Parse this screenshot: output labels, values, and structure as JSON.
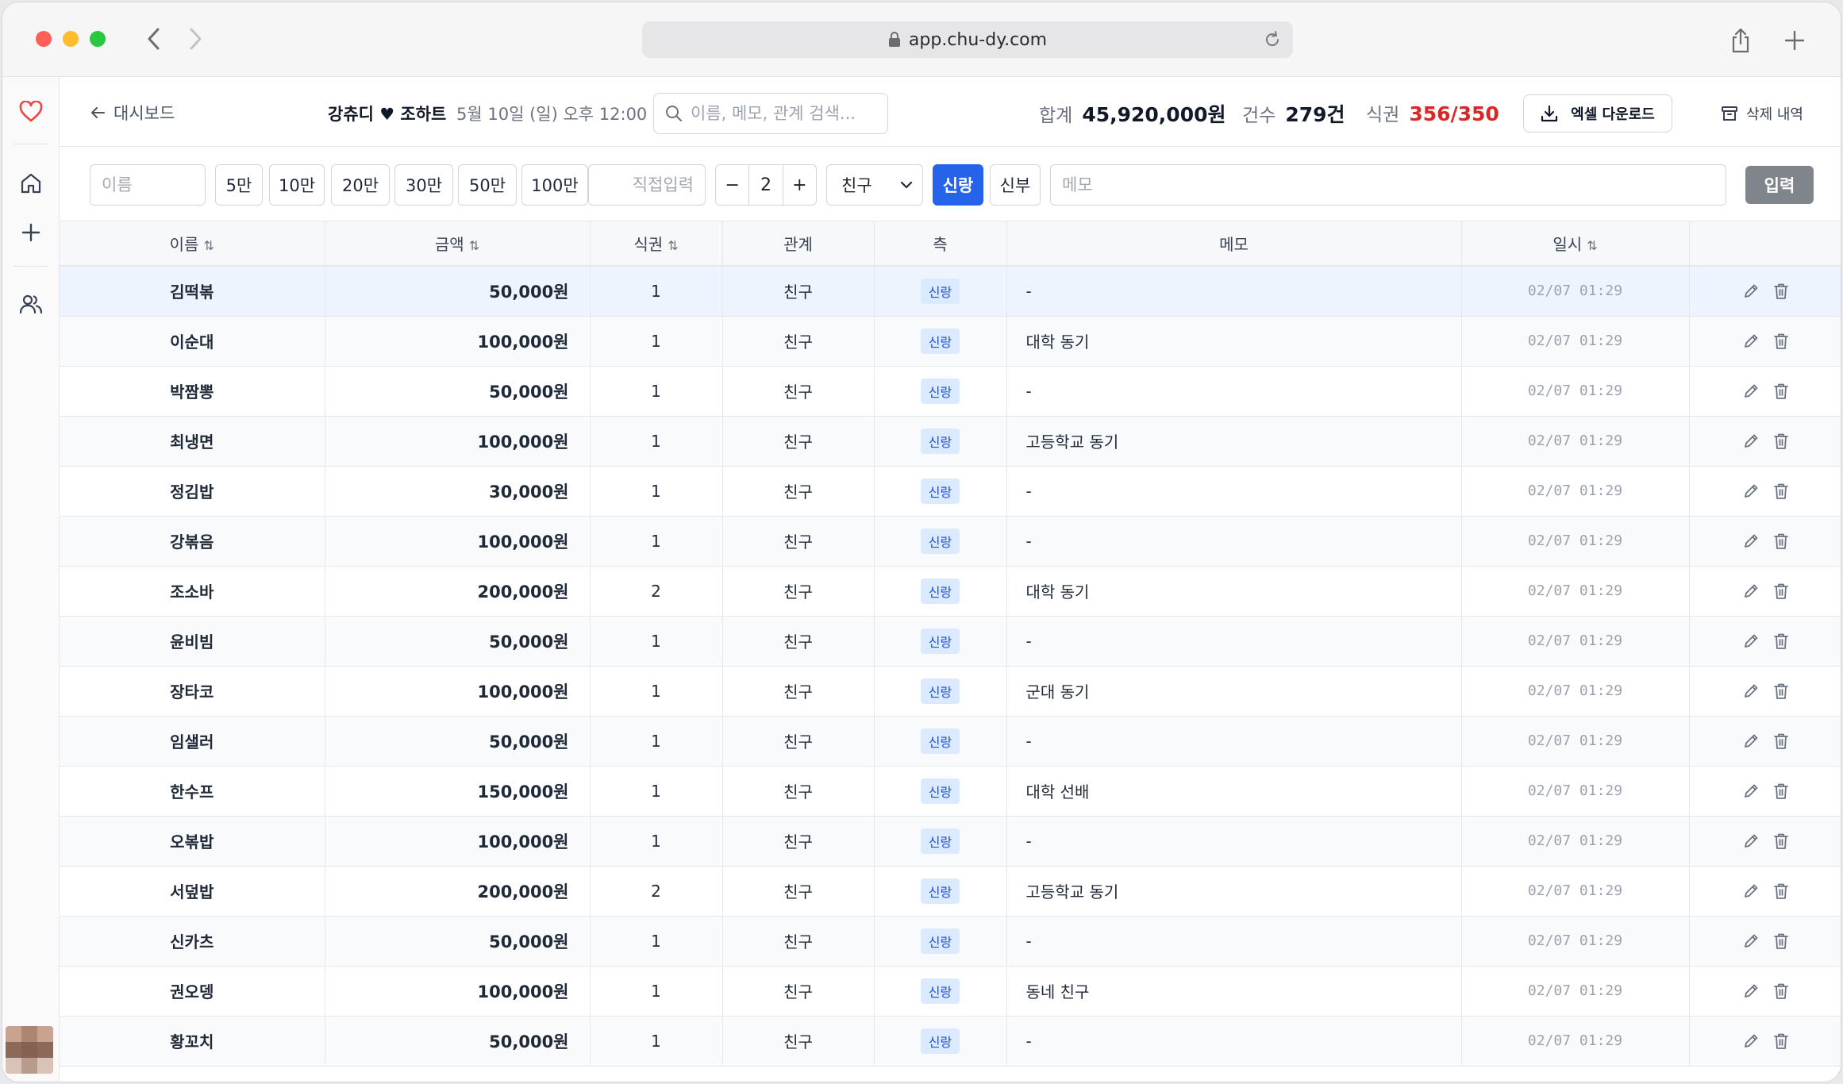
{
  "browser": {
    "url": "app.chu-dy.com"
  },
  "header": {
    "back_label": "대시보드",
    "event_title": "강츄디 ♥ 조하트",
    "event_date": "5월 10일 (일) 오후 12:00",
    "search_placeholder": "이름, 메모, 관계 검색...",
    "total_label": "합계",
    "total_value": "45,920,000원",
    "count_label": "건수",
    "count_value": "279건",
    "meal_label": "식권",
    "meal_value": "356/350",
    "excel_label": "엑셀 다운로드",
    "deleted_label": "삭제 내역"
  },
  "toolbar": {
    "name_placeholder": "이름",
    "amounts": [
      "5만",
      "10만",
      "20만",
      "30만",
      "50만",
      "100만"
    ],
    "direct_placeholder": "직접입력",
    "stepper_minus": "−",
    "stepper_value": "2",
    "stepper_plus": "+",
    "relation_selected": "친구",
    "side_groom": "신랑",
    "side_bride": "신부",
    "memo_placeholder": "메모",
    "submit_label": "입력"
  },
  "table": {
    "columns": [
      "이름",
      "금액",
      "식권",
      "관계",
      "측",
      "메모",
      "일시"
    ],
    "sort_glyph": "⇅",
    "rows": [
      {
        "name": "김떡볶",
        "amount": "50,000원",
        "meal": "1",
        "relation": "친구",
        "side": "신랑",
        "memo": "-",
        "time": "02/07 01:29"
      },
      {
        "name": "이순대",
        "amount": "100,000원",
        "meal": "1",
        "relation": "친구",
        "side": "신랑",
        "memo": "대학 동기",
        "time": "02/07 01:29"
      },
      {
        "name": "박짬뽕",
        "amount": "50,000원",
        "meal": "1",
        "relation": "친구",
        "side": "신랑",
        "memo": "-",
        "time": "02/07 01:29"
      },
      {
        "name": "최냉면",
        "amount": "100,000원",
        "meal": "1",
        "relation": "친구",
        "side": "신랑",
        "memo": "고등학교 동기",
        "time": "02/07 01:29"
      },
      {
        "name": "정김밥",
        "amount": "30,000원",
        "meal": "1",
        "relation": "친구",
        "side": "신랑",
        "memo": "-",
        "time": "02/07 01:29"
      },
      {
        "name": "강볶음",
        "amount": "100,000원",
        "meal": "1",
        "relation": "친구",
        "side": "신랑",
        "memo": "-",
        "time": "02/07 01:29"
      },
      {
        "name": "조소바",
        "amount": "200,000원",
        "meal": "2",
        "relation": "친구",
        "side": "신랑",
        "memo": "대학 동기",
        "time": "02/07 01:29"
      },
      {
        "name": "윤비빔",
        "amount": "50,000원",
        "meal": "1",
        "relation": "친구",
        "side": "신랑",
        "memo": "-",
        "time": "02/07 01:29"
      },
      {
        "name": "장타코",
        "amount": "100,000원",
        "meal": "1",
        "relation": "친구",
        "side": "신랑",
        "memo": "군대 동기",
        "time": "02/07 01:29"
      },
      {
        "name": "임샐러",
        "amount": "50,000원",
        "meal": "1",
        "relation": "친구",
        "side": "신랑",
        "memo": "-",
        "time": "02/07 01:29"
      },
      {
        "name": "한수프",
        "amount": "150,000원",
        "meal": "1",
        "relation": "친구",
        "side": "신랑",
        "memo": "대학 선배",
        "time": "02/07 01:29"
      },
      {
        "name": "오볶밥",
        "amount": "100,000원",
        "meal": "1",
        "relation": "친구",
        "side": "신랑",
        "memo": "-",
        "time": "02/07 01:29"
      },
      {
        "name": "서덮밥",
        "amount": "200,000원",
        "meal": "2",
        "relation": "친구",
        "side": "신랑",
        "memo": "고등학교 동기",
        "time": "02/07 01:29"
      },
      {
        "name": "신카츠",
        "amount": "50,000원",
        "meal": "1",
        "relation": "친구",
        "side": "신랑",
        "memo": "-",
        "time": "02/07 01:29"
      },
      {
        "name": "권오뎅",
        "amount": "100,000원",
        "meal": "1",
        "relation": "친구",
        "side": "신랑",
        "memo": "동네 친구",
        "time": "02/07 01:29"
      },
      {
        "name": "황꼬치",
        "amount": "50,000원",
        "meal": "1",
        "relation": "친구",
        "side": "신랑",
        "memo": "-",
        "time": "02/07 01:29"
      }
    ]
  },
  "colors": {
    "accent": "#2563eb",
    "danger": "#dc2626",
    "heart": "#ef4444",
    "badge_bg": "#dbeafe"
  },
  "icons": [
    "lock-icon",
    "reload-icon",
    "share-icon",
    "plus-icon",
    "heart-icon",
    "home-icon",
    "users-icon",
    "search-icon",
    "download-icon",
    "archive-icon",
    "pencil-icon",
    "trash-icon"
  ]
}
